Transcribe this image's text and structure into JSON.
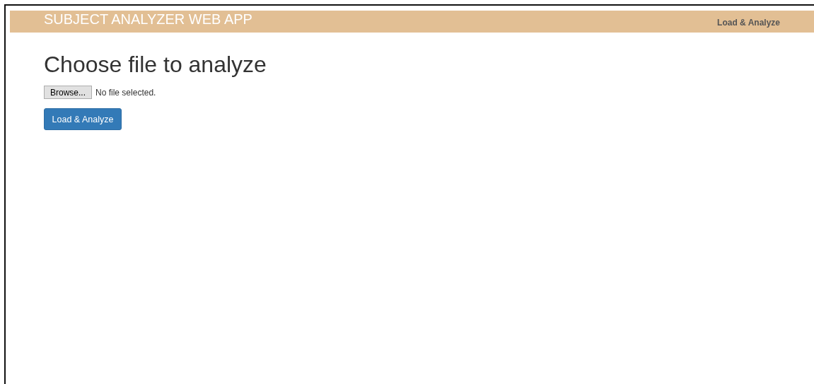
{
  "navbar": {
    "brand": "SUBJECT ANALYZER WEB APP",
    "links": [
      {
        "label": "Load & Analyze"
      }
    ]
  },
  "heading": "Choose file to analyze",
  "file_input": {
    "button": "Browse...",
    "status": "No file selected."
  },
  "submit": {
    "label": "Load & Analyze"
  }
}
